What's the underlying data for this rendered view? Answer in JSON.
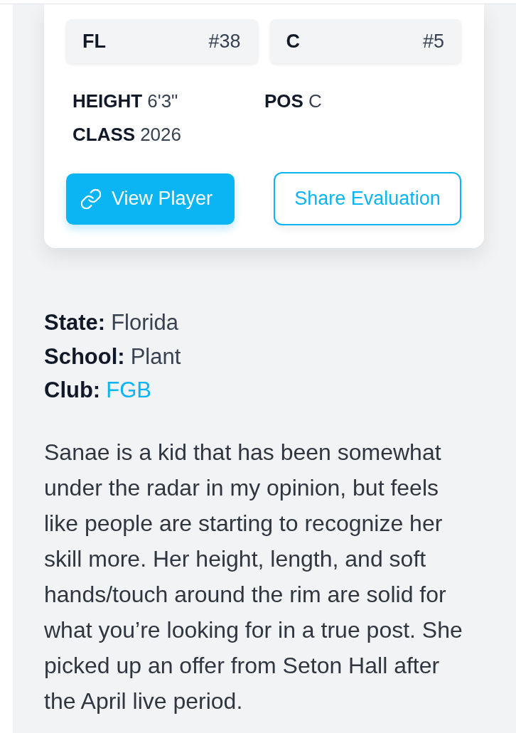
{
  "card": {
    "chips": [
      {
        "label": "FL",
        "number": "#38"
      },
      {
        "label": "C",
        "number": "#5"
      }
    ],
    "fields": [
      {
        "label": "HEIGHT",
        "value": "6'3\""
      },
      {
        "label": "POS",
        "value": "C"
      },
      {
        "label": "CLASS",
        "value": "2026"
      }
    ],
    "buttons": [
      {
        "label": "View Player",
        "kind": "primary"
      },
      {
        "label": "Share Evaluation",
        "kind": "outline"
      }
    ]
  },
  "details": [
    {
      "label": "State:",
      "value": "Florida",
      "kind": "text"
    },
    {
      "label": "School:",
      "value": "Plant",
      "kind": "text"
    },
    {
      "label": "Club:",
      "value": "FGB",
      "kind": "link"
    }
  ],
  "evaluation": "Sanae is a kid that has been somewhat under the radar in my opinion, but feels like people are starting to recognize her skill more. Her height, length, and soft hands/touch around the rim are solid for what you’re looking for in a true post. She picked up an offer from Seton Hall after the April live period."
}
